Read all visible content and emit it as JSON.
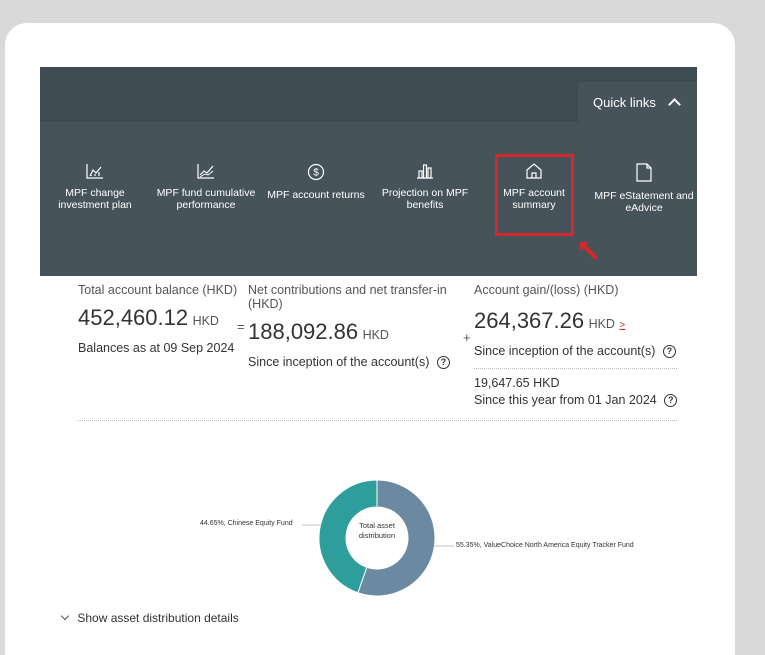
{
  "quick_links": {
    "label": "Quick links",
    "items": [
      {
        "label": "MPF change investment plan",
        "icon": "chart-icon"
      },
      {
        "label": "MPF fund cumulative performance",
        "icon": "line-chart-icon"
      },
      {
        "label": "MPF account returns",
        "icon": "dollar-icon"
      },
      {
        "label": "Projection on MPF benefits",
        "icon": "bar-chart-icon"
      },
      {
        "label": "MPF account summary",
        "icon": "home-icon"
      },
      {
        "label": "MPF eStatement and eAdvice",
        "icon": "document-icon"
      }
    ]
  },
  "summary": {
    "total": {
      "label": "Total account balance (HKD)",
      "value": "452,460.12",
      "currency": "HKD",
      "note": "Balances as at 09 Sep 2024"
    },
    "eq": "=",
    "net": {
      "label": "Net contributions and net transfer-in (HKD)",
      "value": "188,092.86",
      "currency": "HKD",
      "note": "Since inception of the account(s)"
    },
    "plus": "+",
    "gain": {
      "label": "Account gain/(loss) (HKD)",
      "value": "264,367.26",
      "currency": "HKD",
      "note": "Since inception of the account(s)",
      "year_value": "19,647.65 HKD",
      "year_note": "Since this year from 01 Jan 2024"
    }
  },
  "chart_data": {
    "type": "pie",
    "title": "Total asset distribution",
    "slices": [
      {
        "label": "44.65%, Chinese Equity Fund",
        "value": 44.65,
        "color": "#2e9e9c"
      },
      {
        "label": "55.35%, ValueChoice North America Equity Tracker Fund",
        "value": 55.35,
        "color": "#6b8aa1"
      }
    ]
  },
  "toggle": {
    "label": "Show asset distribution details"
  },
  "colors": {
    "nav_bg": "#46535a",
    "highlight": "#d22a2a"
  }
}
